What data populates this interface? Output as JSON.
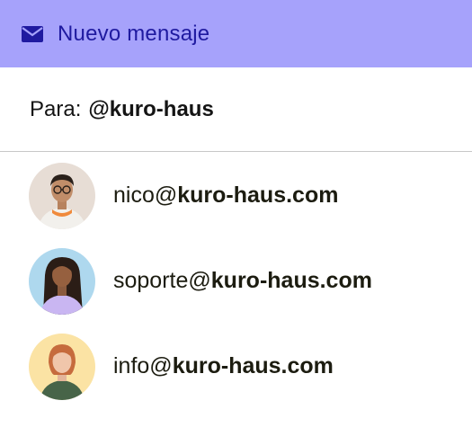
{
  "header": {
    "title": "Nuevo mensaje",
    "icon": "envelope-icon",
    "background": "#a6a2fb",
    "accent": "#1f1aa0"
  },
  "to": {
    "label": "Para:",
    "value": "@kuro-haus"
  },
  "contacts": [
    {
      "local": "nico@",
      "domain": "kuro-haus.com",
      "avatar_bg": "#e7ddd5"
    },
    {
      "local": "soporte@",
      "domain": "kuro-haus.com",
      "avatar_bg": "#aed8ee"
    },
    {
      "local": "info@",
      "domain": "kuro-haus.com",
      "avatar_bg": "#fbe3a4"
    }
  ]
}
